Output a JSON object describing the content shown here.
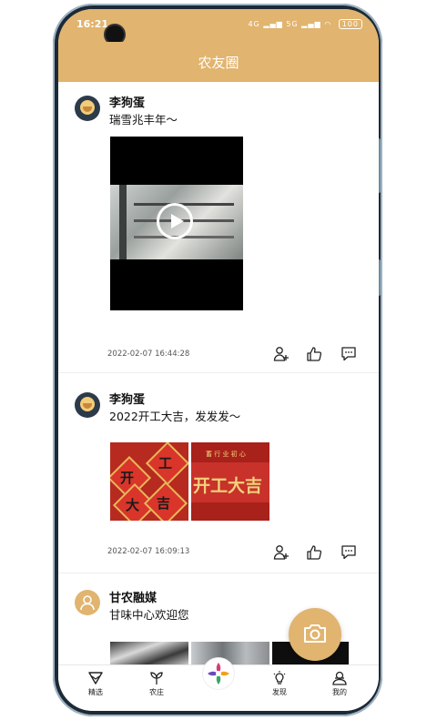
{
  "status_bar": {
    "time": "16:21",
    "signal_1": "4G",
    "signal_2": "5G",
    "battery": "100"
  },
  "header": {
    "title": "农友圈"
  },
  "posts": [
    {
      "user": "李狗蛋",
      "text": "瑞雪兆丰年～",
      "timestamp": "2022-02-07 16:44:28",
      "media": "video"
    },
    {
      "user": "李狗蛋",
      "text": "2022开工大吉，发发发～",
      "timestamp": "2022-02-07 16:09:13",
      "media": "images",
      "image_1_chars": [
        "开",
        "工",
        "大",
        "吉"
      ],
      "image_2_big": "开工大吉",
      "image_2_small": "蓄 行 业 初 心"
    },
    {
      "user": "甘农融媒",
      "text": "甘味中心欢迎您",
      "media": "images"
    }
  ],
  "tabbar": {
    "items": [
      {
        "label": "精选"
      },
      {
        "label": "农庄"
      },
      {
        "label": ""
      },
      {
        "label": "发现"
      },
      {
        "label": "我的"
      }
    ]
  },
  "colors": {
    "accent": "#e1b46f",
    "text": "#111111",
    "muted": "#555555"
  }
}
